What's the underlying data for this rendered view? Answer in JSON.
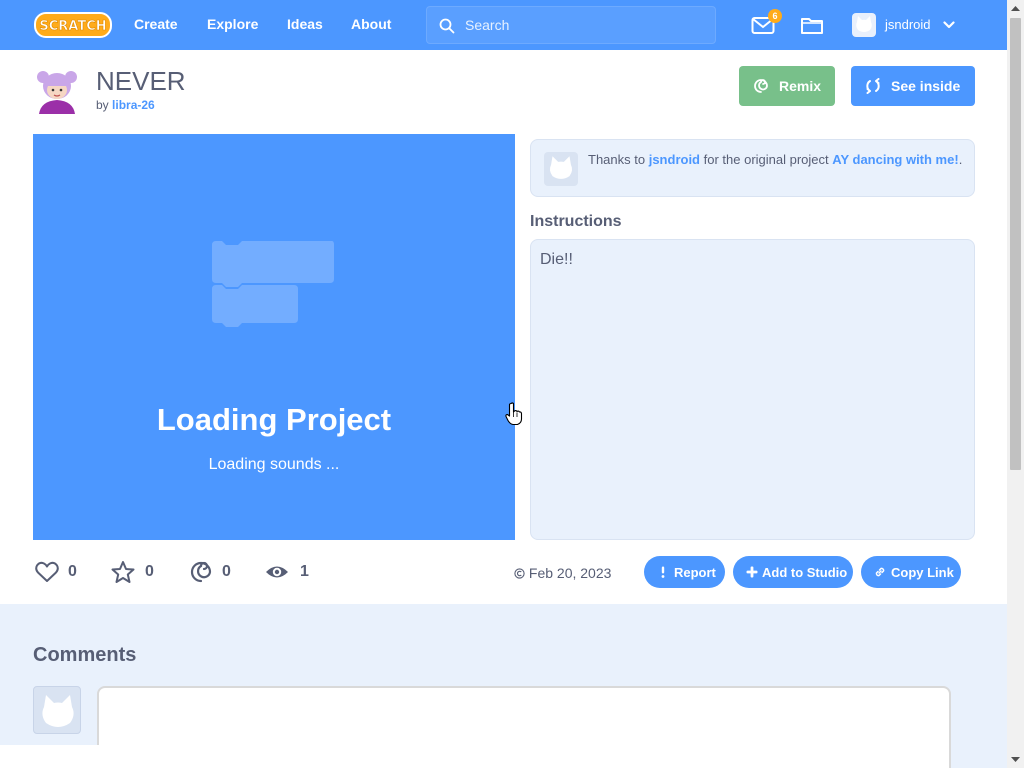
{
  "navbar": {
    "logo_text": "SCRATCH",
    "links": [
      "Create",
      "Explore",
      "Ideas",
      "About"
    ],
    "search_placeholder": "Search",
    "message_count": "6",
    "username": "jsndroid"
  },
  "project": {
    "title": "NEVER",
    "by_prefix": "by",
    "author": "libra-26",
    "remix_label": "Remix",
    "see_inside_label": "See inside"
  },
  "stage": {
    "loading_title": "Loading Project",
    "loading_sub": "Loading sounds ..."
  },
  "credit": {
    "prefix": "Thanks to",
    "user": "jsndroid",
    "middle": "for the original project",
    "project": "AY dancing with me!",
    "suffix": "."
  },
  "instructions": {
    "heading": "Instructions",
    "text": "Die!!"
  },
  "stats": {
    "loves": "0",
    "favorites": "0",
    "remixes": "0",
    "views": "1",
    "date": "Feb 20, 2023"
  },
  "actions": {
    "report": "Report",
    "add_to_studio": "Add to Studio",
    "copy_link": "Copy Link"
  },
  "comments": {
    "title": "Comments"
  },
  "colors": {
    "brand_blue": "#4c97ff",
    "remix_green": "#78c08a",
    "badge_orange": "#ffab1a",
    "panel_bg": "#e9f1fc"
  }
}
